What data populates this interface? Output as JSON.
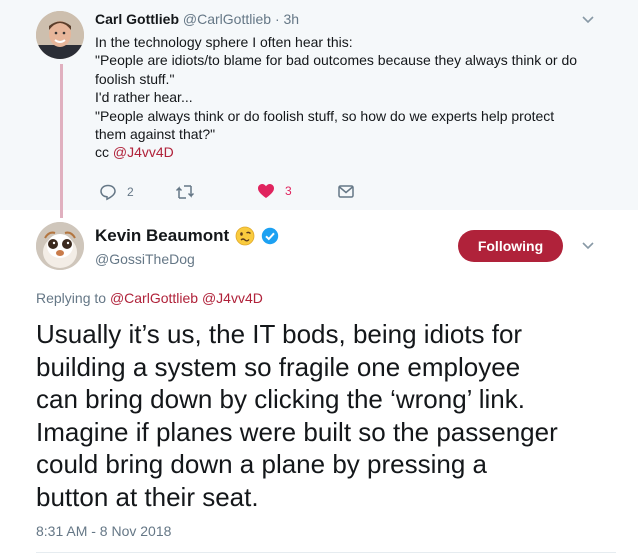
{
  "parent_tweet": {
    "author_name": "Carl Gottlieb",
    "handle": "@CarlGottlieb",
    "time": "· 3h",
    "lines": [
      "In the technology sphere I often hear this:",
      "\"People are idiots/to blame for bad outcomes because they always think or do",
      "foolish stuff.\"",
      "I'd rather hear...",
      "\"People always think or do foolish stuff, so how do we experts help protect",
      "them against that?\""
    ],
    "cc_label": "cc ",
    "cc_mention": "@J4vv4D",
    "reply_count": "2",
    "retweet_count": "",
    "like_count": "3"
  },
  "main_tweet": {
    "author_name": "Kevin Beaumont",
    "handle": "@GossiTheDog",
    "follow_label": "Following",
    "replying_label": "Replying to ",
    "replying_mentions": "@CarlGottlieb @J4vv4D",
    "lines": [
      "Usually it’s us, the IT bods, being idiots for",
      "building a system so fragile one employee",
      "can bring down by clicking the ‘wrong’ link.",
      "Imagine if planes were built so the passenger",
      "could bring down a plane by pressing a",
      "button at their seat."
    ],
    "timestamp": "8:31 AM - 8 Nov 2018"
  },
  "colors": {
    "accent": "#b0223a",
    "like": "#e0245e",
    "muted": "#657786",
    "verified": "#1da1f2",
    "parent_bg": "#f5f8fa"
  },
  "icons": {
    "reply": "reply-icon",
    "retweet": "retweet-icon",
    "like": "heart-icon",
    "dm": "envelope-icon",
    "verified": "verified-badge-icon",
    "emoji": "woozy-face-emoji-icon",
    "more": "chevron-down-icon"
  }
}
